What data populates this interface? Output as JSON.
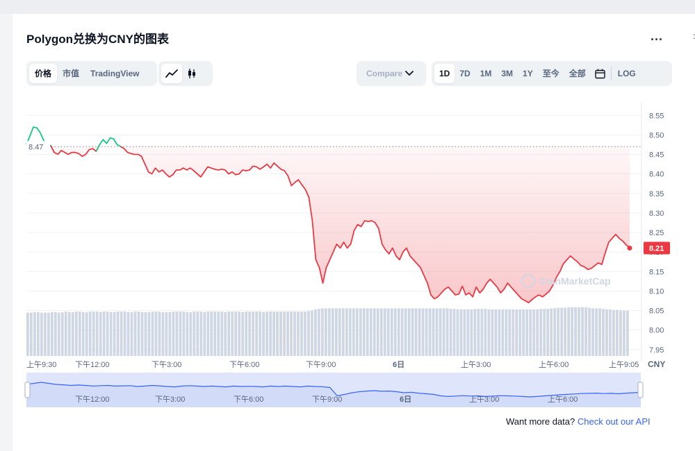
{
  "header": {
    "title": "Polygon兑换为CNY的图表",
    "more_label": "...",
    "edge_glyph": ":"
  },
  "toolbar": {
    "tabs": [
      {
        "label": "价格",
        "active": true
      },
      {
        "label": "市值",
        "active": false
      },
      {
        "label": "TradingView",
        "active": false
      }
    ],
    "chart_modes": [
      {
        "icon": "line-chart-icon",
        "active": true
      },
      {
        "icon": "candlestick-icon",
        "active": false
      }
    ],
    "compare": {
      "label": "Compare",
      "icon": "chevron-down-icon"
    },
    "ranges": [
      {
        "label": "1D",
        "active": true
      },
      {
        "label": "7D",
        "active": false
      },
      {
        "label": "1M",
        "active": false
      },
      {
        "label": "3M",
        "active": false
      },
      {
        "label": "1Y",
        "active": false
      },
      {
        "label": "至今",
        "active": false
      },
      {
        "label": "全部",
        "active": false
      }
    ],
    "calendar_icon": "calendar-icon",
    "log_label": "LOG"
  },
  "footer": {
    "text": "Want more data? ",
    "link": "Check out our API"
  },
  "chart_data": {
    "type": "line",
    "currency_label": "CNY",
    "watermark": "CoinMarketCap",
    "open_price": 8.47,
    "open_price_label": "8.47",
    "current_price": 8.21,
    "current_price_label": "8.21",
    "ylim": [
      7.93,
      8.57
    ],
    "yticks": [
      "8.55",
      "8.50",
      "8.45",
      "8.40",
      "8.35",
      "8.30",
      "8.25",
      "8.20",
      "8.15",
      "8.10",
      "8.05",
      "8.00",
      "7.95"
    ],
    "xlim": [
      "上午9:30",
      "上午9:05"
    ],
    "xtick_labels": [
      "上午9:30",
      "下午12:00",
      "下午3:00",
      "下午6:00",
      "下午9:00",
      "6日",
      "上午3:00",
      "上午6:00",
      "上午9:05"
    ],
    "navigator_labels": [
      "下午12:00",
      "下午3:00",
      "下午6:00",
      "下午9:00",
      "6日",
      "上午3:00",
      "上午6:00"
    ],
    "colors": {
      "up": "#16c784",
      "down": "#ea3943",
      "volume": "#cfd6e4",
      "navigator_fill": "#dfe5fb",
      "navigator_line": "#3861fb"
    },
    "series": [
      {
        "values": [
          8.475,
          8.497,
          8.52,
          8.518,
          8.505,
          8.485,
          8.478,
          8.472,
          8.455,
          8.45,
          8.46,
          8.455,
          8.45,
          8.455,
          8.455,
          8.452,
          8.445,
          8.45,
          8.462,
          8.465,
          8.458,
          8.475,
          8.488,
          8.478,
          8.492,
          8.49,
          8.475,
          8.47,
          8.465,
          8.455,
          8.452,
          8.45,
          8.45,
          8.445,
          8.425,
          8.405,
          8.4,
          8.415,
          8.405,
          8.41,
          8.4,
          8.392,
          8.398,
          8.41,
          8.41,
          8.415,
          8.41,
          8.415,
          8.408,
          8.4,
          8.392,
          8.405,
          8.418,
          8.415,
          8.412,
          8.41,
          8.412,
          8.41,
          8.4,
          8.405,
          8.398,
          8.4,
          8.41,
          8.408,
          8.41,
          8.42,
          8.418,
          8.412,
          8.418,
          8.425,
          8.415,
          8.428,
          8.42,
          8.412,
          8.408,
          8.395,
          8.37,
          8.378,
          8.385,
          8.372,
          8.36,
          8.34,
          8.28,
          8.18,
          8.16,
          8.12,
          8.16,
          8.18,
          8.2,
          8.22,
          8.21,
          8.225,
          8.21,
          8.22,
          8.255,
          8.27,
          8.265,
          8.28,
          8.278,
          8.28,
          8.275,
          8.26,
          8.22,
          8.205,
          8.195,
          8.21,
          8.19,
          8.18,
          8.2,
          8.21,
          8.19,
          8.18,
          8.17,
          8.16,
          8.14,
          8.12,
          8.09,
          8.08,
          8.085,
          8.095,
          8.105,
          8.11,
          8.1,
          8.09,
          8.092,
          8.112,
          8.09,
          8.095,
          8.085,
          8.11,
          8.095,
          8.105,
          8.12,
          8.13,
          8.12,
          8.11,
          8.095,
          8.105,
          8.12,
          8.11,
          8.1,
          8.09,
          8.08,
          8.075,
          8.07,
          8.078,
          8.085,
          8.09,
          8.085,
          8.092,
          8.1,
          8.115,
          8.135,
          8.15,
          8.17,
          8.18,
          8.19,
          8.182,
          8.175,
          8.165,
          8.162,
          8.155,
          8.158,
          8.165,
          8.172,
          8.168,
          8.198,
          8.225,
          8.235,
          8.245,
          8.235,
          8.228,
          8.218,
          8.21
        ]
      }
    ],
    "volume": [
      0.8,
      0.8,
      0.81,
      0.81,
      0.8,
      0.8,
      0.8,
      0.81,
      0.81,
      0.8,
      0.81,
      0.82,
      0.81,
      0.81,
      0.82,
      0.82,
      0.81,
      0.81,
      0.82,
      0.82,
      0.82,
      0.81,
      0.82,
      0.82,
      0.81,
      0.81,
      0.82,
      0.82,
      0.82,
      0.81,
      0.81,
      0.82,
      0.82,
      0.81,
      0.81,
      0.81,
      0.82,
      0.82,
      0.82,
      0.81,
      0.81,
      0.81,
      0.82,
      0.82,
      0.82,
      0.82,
      0.81,
      0.81,
      0.82,
      0.82,
      0.82,
      0.81,
      0.82,
      0.82,
      0.82,
      0.82,
      0.82,
      0.81,
      0.82,
      0.82,
      0.82,
      0.82,
      0.81,
      0.82,
      0.82,
      0.82,
      0.82,
      0.82,
      0.81,
      0.82,
      0.82,
      0.82,
      0.82,
      0.82,
      0.82,
      0.82,
      0.82,
      0.82,
      0.82,
      0.82,
      0.82,
      0.83,
      0.84,
      0.86,
      0.87,
      0.88,
      0.88,
      0.88,
      0.88,
      0.88,
      0.88,
      0.88,
      0.88,
      0.88,
      0.88,
      0.88,
      0.88,
      0.88,
      0.88,
      0.88,
      0.88,
      0.88,
      0.88,
      0.88,
      0.88,
      0.88,
      0.88,
      0.88,
      0.88,
      0.88,
      0.88,
      0.88,
      0.88,
      0.88,
      0.88,
      0.88,
      0.88,
      0.88,
      0.88,
      0.88,
      0.88,
      0.88,
      0.87,
      0.87,
      0.86,
      0.86,
      0.86,
      0.86,
      0.86,
      0.87,
      0.87,
      0.87,
      0.87,
      0.86,
      0.86,
      0.86,
      0.86,
      0.86,
      0.86,
      0.86,
      0.86,
      0.86,
      0.86,
      0.86,
      0.86,
      0.86,
      0.86,
      0.86,
      0.87,
      0.87,
      0.87,
      0.88,
      0.88,
      0.89,
      0.89,
      0.89,
      0.9,
      0.9,
      0.9,
      0.9,
      0.9,
      0.9,
      0.89,
      0.88,
      0.88,
      0.88,
      0.87,
      0.86,
      0.86,
      0.85,
      0.85,
      0.84,
      0.84,
      0.84
    ],
    "navigator": [
      0.3,
      0.25,
      0.2,
      0.25,
      0.3,
      0.32,
      0.35,
      0.33,
      0.35,
      0.38,
      0.36,
      0.35,
      0.38,
      0.37,
      0.36,
      0.4,
      0.38,
      0.35,
      0.37,
      0.4,
      0.42,
      0.38,
      0.36,
      0.38,
      0.4,
      0.38,
      0.4,
      0.42,
      0.38,
      0.4,
      0.39,
      0.4,
      0.42,
      0.38,
      0.4,
      0.38,
      0.4,
      0.42,
      0.38,
      0.4,
      0.41,
      0.45,
      0.85,
      0.78,
      0.7,
      0.65,
      0.62,
      0.6,
      0.63,
      0.62,
      0.65,
      0.7,
      0.68,
      0.72,
      0.75,
      0.78,
      0.85,
      0.88,
      0.86,
      0.84,
      0.86,
      0.85,
      0.88,
      0.86,
      0.84,
      0.85,
      0.86,
      0.88,
      0.9,
      0.88,
      0.85,
      0.83,
      0.8,
      0.78,
      0.76,
      0.74,
      0.73,
      0.72,
      0.74,
      0.73,
      0.75,
      0.72,
      0.7,
      0.68
    ]
  }
}
